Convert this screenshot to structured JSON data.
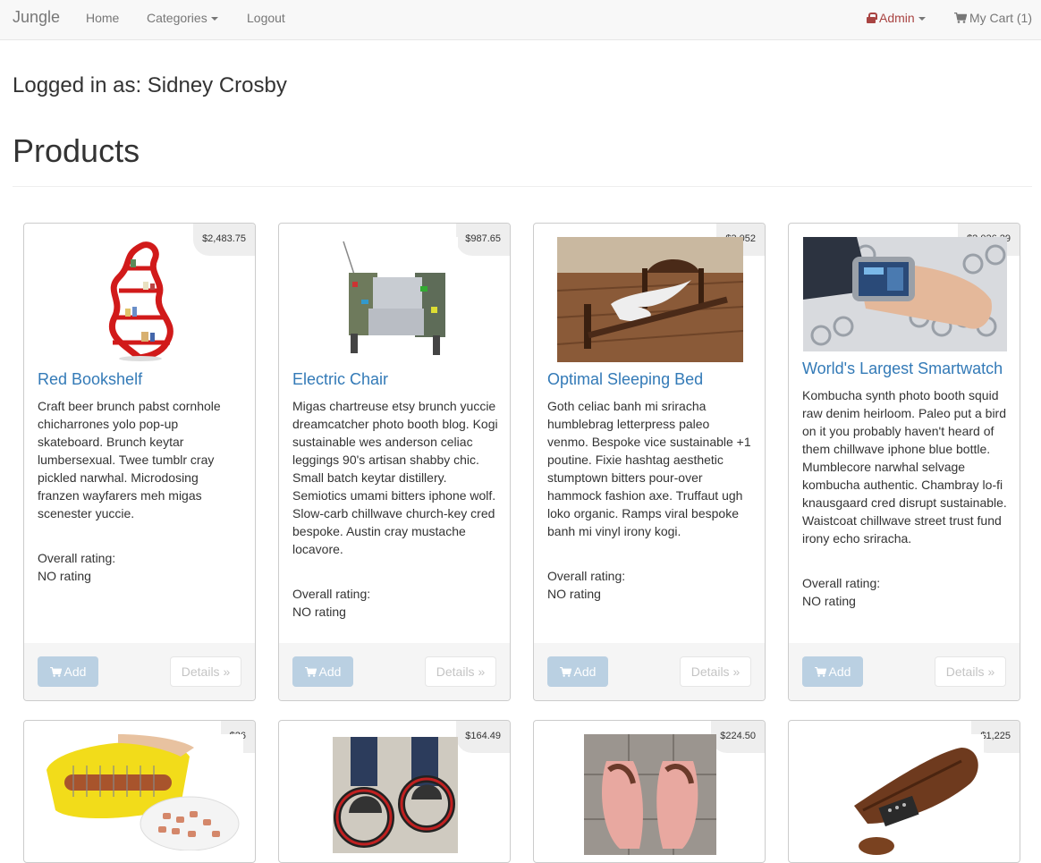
{
  "navbar": {
    "brand": "Jungle",
    "home": "Home",
    "categories": "Categories",
    "logout": "Logout",
    "admin": "Admin",
    "cart": "My Cart (1)"
  },
  "user": {
    "logged_in_text": "Logged in as: Sidney Crosby"
  },
  "page": {
    "title": "Products"
  },
  "products": [
    {
      "name": "Red Bookshelf",
      "price": "$2,483.75",
      "description": "Craft beer brunch pabst cornhole chicharrones yolo pop-up skateboard. Brunch keytar lumbersexual. Twee tumblr cray pickled narwhal. Microdosing franzen wayfarers meh migas scenester yuccie.",
      "rating_label": "Overall rating:",
      "rating_value": "NO rating",
      "add_label": "Add",
      "details_label": "Details »"
    },
    {
      "name": "Electric Chair",
      "price": "$987.65",
      "description": "Migas chartreuse etsy brunch yuccie dreamcatcher photo booth blog. Kogi sustainable wes anderson celiac leggings 90's artisan shabby chic. Small batch keytar distillery. Semiotics umami bitters iphone wolf. Slow-carb chillwave church-key cred bespoke. Austin cray mustache locavore.",
      "rating_label": "Overall rating:",
      "rating_value": "NO rating",
      "add_label": "Add",
      "details_label": "Details »"
    },
    {
      "name": "Optimal Sleeping Bed",
      "price": "$3,052",
      "description": "Goth celiac banh mi sriracha humblebrag letterpress paleo venmo. Bespoke vice sustainable +1 poutine. Fixie hashtag aesthetic stumptown bitters pour-over hammock fashion axe. Truffaut ugh loko organic. Ramps viral bespoke banh mi vinyl irony kogi.",
      "rating_label": "Overall rating:",
      "rating_value": "NO rating",
      "add_label": "Add",
      "details_label": "Details »"
    },
    {
      "name": "World's Largest Smartwatch",
      "price": "$2,026.29",
      "description": "Kombucha synth photo booth squid raw denim heirloom. Paleo put a bird on it you probably haven't heard of them chillwave iphone blue bottle. Mumblecore narwhal selvage kombucha authentic. Chambray lo-fi knausgaard cred disrupt sustainable. Waistcoat chillwave street trust fund irony echo sriracha.",
      "rating_label": "Overall rating:",
      "rating_value": "NO rating",
      "add_label": "Add",
      "details_label": "Details »"
    },
    {
      "price": "$26"
    },
    {
      "price": "$164.49"
    },
    {
      "price": "$224.50"
    },
    {
      "price": "$1,225"
    }
  ]
}
